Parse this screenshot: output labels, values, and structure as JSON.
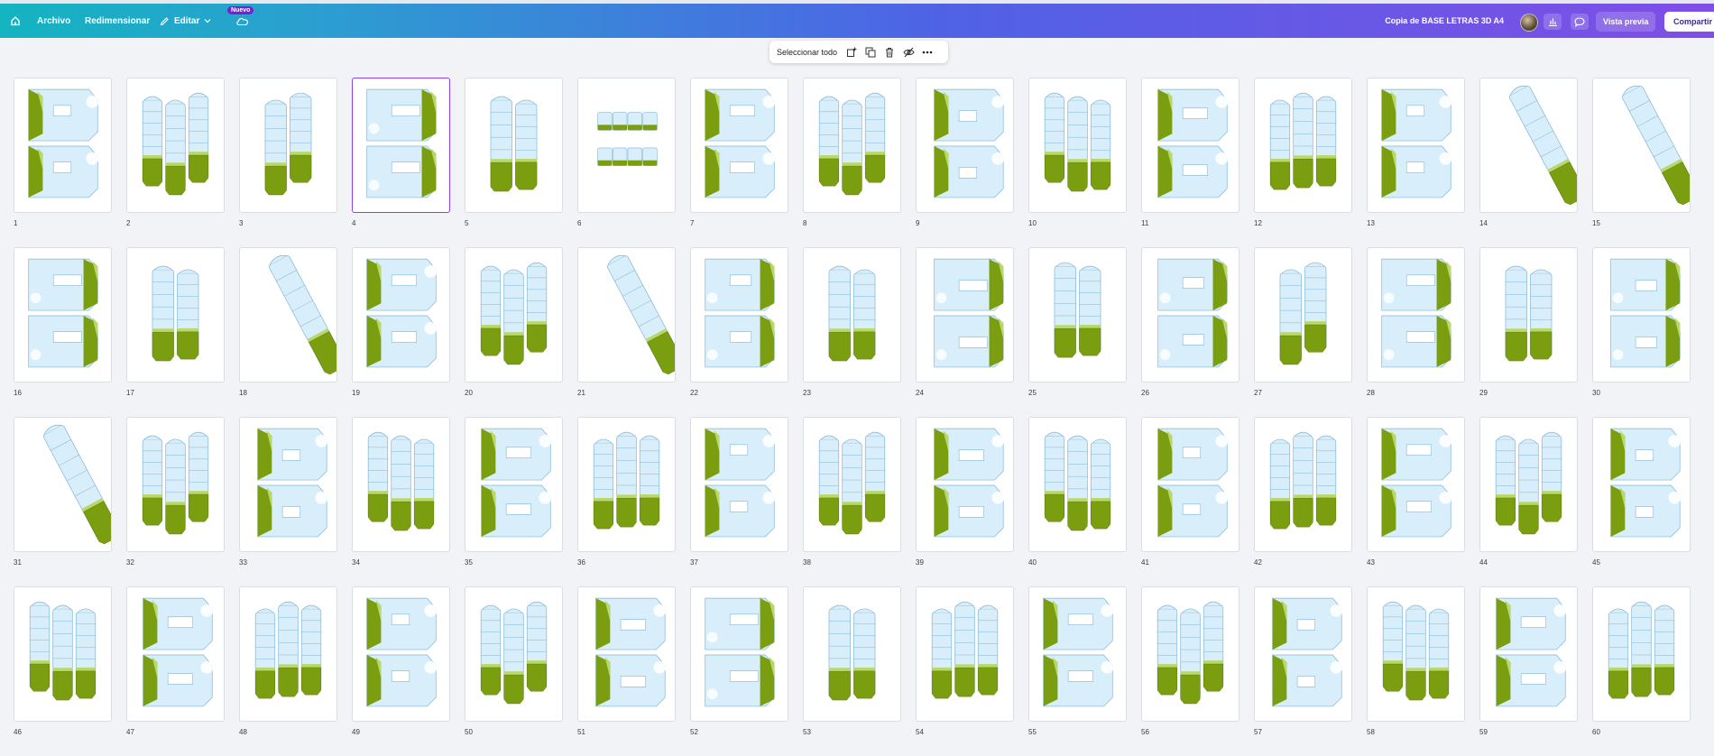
{
  "topbar": {
    "archivo": "Archivo",
    "redimensionar": "Redimensionar",
    "editar": "Editar",
    "nuevo_badge": "Nuevo",
    "document_title": "Copia de BASE LETRAS 3D A4",
    "vista_previa": "Vista previa",
    "compartir": "Compartir"
  },
  "floating_toolbar": {
    "select_all": "Seleccionar todo"
  },
  "colors": {
    "gradient_start": "#14b4c1",
    "gradient_end": "#7f4ee6",
    "selection": "#8a3ff0",
    "piece_fill": "#d8effb",
    "piece_stroke": "#7fb3d5",
    "green": "#7a9e0f",
    "light_green": "#b8d96a"
  },
  "selected_page": "4",
  "pages": [
    {
      "label": "1",
      "kind": "letter"
    },
    {
      "label": "2",
      "kind": "boxes"
    },
    {
      "label": "3",
      "kind": "boxes"
    },
    {
      "label": "4",
      "kind": "letter"
    },
    {
      "label": "5",
      "kind": "boxes"
    },
    {
      "label": "6",
      "kind": "flat"
    },
    {
      "label": "7",
      "kind": "letter"
    },
    {
      "label": "8",
      "kind": "boxes"
    },
    {
      "label": "9",
      "kind": "letter"
    },
    {
      "label": "10",
      "kind": "boxes"
    },
    {
      "label": "11",
      "kind": "letter"
    },
    {
      "label": "12",
      "kind": "boxes"
    },
    {
      "label": "13",
      "kind": "letter"
    },
    {
      "label": "14",
      "kind": "diagonal"
    },
    {
      "label": "15",
      "kind": "diagonal"
    },
    {
      "label": "16",
      "kind": "letter"
    },
    {
      "label": "17",
      "kind": "boxes"
    },
    {
      "label": "18",
      "kind": "diagonal"
    },
    {
      "label": "19",
      "kind": "letter"
    },
    {
      "label": "20",
      "kind": "boxes"
    },
    {
      "label": "21",
      "kind": "diagonal"
    },
    {
      "label": "22",
      "kind": "letter"
    },
    {
      "label": "23",
      "kind": "boxes"
    },
    {
      "label": "24",
      "kind": "letter"
    },
    {
      "label": "25",
      "kind": "boxes"
    },
    {
      "label": "26",
      "kind": "letter"
    },
    {
      "label": "27",
      "kind": "boxes"
    },
    {
      "label": "28",
      "kind": "letter"
    },
    {
      "label": "29",
      "kind": "boxes"
    },
    {
      "label": "30",
      "kind": "letter"
    },
    {
      "label": "31",
      "kind": "diagonal"
    },
    {
      "label": "32",
      "kind": "boxes"
    },
    {
      "label": "33",
      "kind": "letter"
    },
    {
      "label": "34",
      "kind": "boxes"
    },
    {
      "label": "35",
      "kind": "letter"
    },
    {
      "label": "36",
      "kind": "boxes"
    },
    {
      "label": "37",
      "kind": "letter"
    },
    {
      "label": "38",
      "kind": "boxes"
    },
    {
      "label": "39",
      "kind": "letter"
    },
    {
      "label": "40",
      "kind": "boxes"
    },
    {
      "label": "41",
      "kind": "letter"
    },
    {
      "label": "42",
      "kind": "boxes"
    },
    {
      "label": "43",
      "kind": "letter"
    },
    {
      "label": "44",
      "kind": "boxes"
    },
    {
      "label": "45",
      "kind": "letter"
    },
    {
      "label": "46",
      "kind": "boxes"
    },
    {
      "label": "47",
      "kind": "letter"
    },
    {
      "label": "48",
      "kind": "boxes"
    },
    {
      "label": "49",
      "kind": "letter"
    },
    {
      "label": "50",
      "kind": "boxes"
    },
    {
      "label": "51",
      "kind": "letter"
    },
    {
      "label": "52",
      "kind": "letter"
    },
    {
      "label": "53",
      "kind": "boxes"
    },
    {
      "label": "54",
      "kind": "boxes"
    },
    {
      "label": "55",
      "kind": "letter"
    },
    {
      "label": "56",
      "kind": "boxes"
    },
    {
      "label": "57",
      "kind": "letter"
    },
    {
      "label": "58",
      "kind": "boxes"
    },
    {
      "label": "59",
      "kind": "letter"
    },
    {
      "label": "60",
      "kind": "boxes"
    }
  ]
}
